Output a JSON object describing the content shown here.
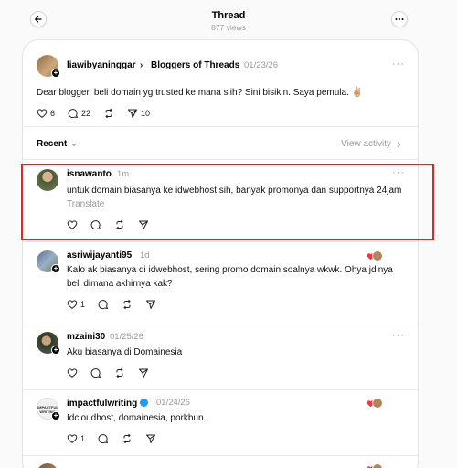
{
  "header": {
    "title": "Thread",
    "views": "877 views"
  },
  "original_post": {
    "username": "liawibyaninggar",
    "separator": "›",
    "topic": "Bloggers of Threads",
    "date": "01/23/26",
    "text": "Dear blogger, beli domain yg trusted ke mana siih? Sini bisikin. Saya pemula. ✌🏼",
    "likes": "6",
    "replies": "22",
    "shares": "10"
  },
  "sort": {
    "label": "Recent",
    "view_activity": "View activity"
  },
  "replies": [
    {
      "username": "isnawanto",
      "time": "1m",
      "text": "untuk domain biasanya ke idwebhost sih, banyak promonya dan supportnya 24jam",
      "translate": "Translate",
      "likes": ""
    },
    {
      "username": "asriwijayanti95",
      "time": "1d",
      "text": "Kalo ak biasanya di idwebhost, sering promo domain soalnya wkwk. Ohya jdinya beli dimana akhirnya kak?",
      "likes": "1"
    },
    {
      "username": "mzaini30",
      "time": "01/25/26",
      "text": "Aku biasanya di Domainesia",
      "likes": ""
    },
    {
      "username": "impactfulwriting",
      "time": "01/24/26",
      "text": "Idcloudhost, domainesia, porkbun.",
      "likes": "1"
    }
  ],
  "colors": {
    "accent_highlight": "#e0252a",
    "verified": "#1d9bf0",
    "muted": "#999999"
  }
}
